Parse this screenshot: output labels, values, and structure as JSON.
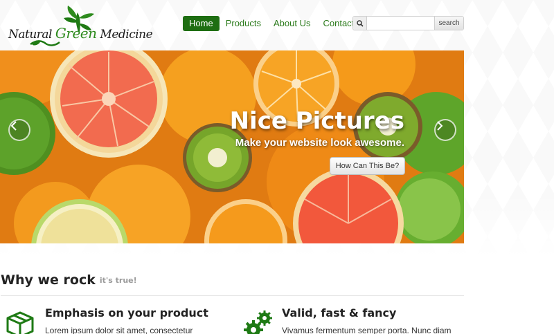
{
  "brand": {
    "logo_word1": "Natural",
    "logo_word2": "Green",
    "logo_word3": "Medicine",
    "accent_color": "#1e6e12",
    "link_color": "#2a7a1a"
  },
  "nav": {
    "items": [
      {
        "label": "Home",
        "active": true
      },
      {
        "label": "Products",
        "active": false
      },
      {
        "label": "About Us",
        "active": false
      },
      {
        "label": "Contact",
        "active": false
      }
    ]
  },
  "search": {
    "icon": "search-icon",
    "placeholder": "",
    "value": "",
    "button_label": "search"
  },
  "hero": {
    "title": "Nice Pictures",
    "subtitle": "Make your website look awesome.",
    "button_label": "How Can This Be?",
    "prev_icon": "chevron-left-icon",
    "next_icon": "chevron-right-icon"
  },
  "section": {
    "title": "Why we rock",
    "subtitle": "it's true!"
  },
  "features": [
    {
      "icon": "box-icon",
      "title": "Emphasis on your product",
      "text": "Lorem ipsum dolor sit amet, consectetur"
    },
    {
      "icon": "gears-icon",
      "title": "Valid, fast & fancy",
      "text": "Vivamus fermentum semper porta. Nunc diam"
    }
  ]
}
